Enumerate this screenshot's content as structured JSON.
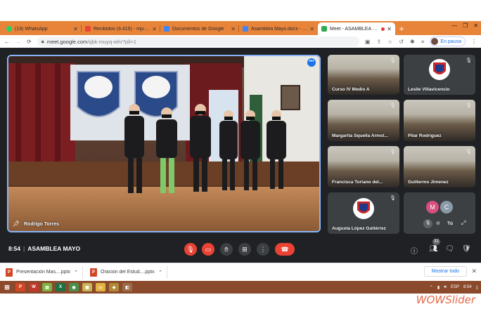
{
  "browser": {
    "tabs": [
      {
        "title": "(19) WhatsApp",
        "color": "#25d366",
        "active": false
      },
      {
        "title": "Recibidos (9.415) - mjvillanue",
        "color": "#ea4335",
        "active": false
      },
      {
        "title": "Documentos de Google",
        "color": "#4285f4",
        "active": false
      },
      {
        "title": "Asamblea Mayo.docx - Docum",
        "color": "#4285f4",
        "active": false
      },
      {
        "title": "Meet - ASAMBLEA MAYO",
        "color": "#34a853",
        "active": true
      }
    ],
    "new_tab": "+",
    "url_host": "meet.google.com",
    "url_path": "/qbk-muyq-whr?pli=1",
    "profile_status": "En pausa"
  },
  "meet": {
    "time": "8:54",
    "meeting_title": "ASAMBLEA MAYO",
    "presenter_name": "Rodrigo Torres",
    "participants_count": "32",
    "tiles": [
      {
        "name": "Curso IV Medio A"
      },
      {
        "name": "Leslie Villavicencio"
      },
      {
        "name": "Margarita Squella Armst..."
      },
      {
        "name": "Pilar Rodriguez"
      },
      {
        "name": "Francisca Toriano del..."
      },
      {
        "name": "Guillermo Jimenez"
      },
      {
        "name": "Augusta López Gutiérrez"
      }
    ],
    "self_tile": {
      "avatars": [
        "M",
        "C"
      ],
      "label": "Tú"
    }
  },
  "downloads": {
    "items": [
      {
        "name": "Presentación Mas....pptx"
      },
      {
        "name": "Oración del Estud....pptx"
      }
    ],
    "show_all": "Mostrar todo"
  },
  "taskbar": {
    "lang": "ESP",
    "clock": "8:54"
  },
  "watermark": "WOWSlider",
  "colors": {
    "accent_blue": "#8ab4f8",
    "meet_bg": "#202124",
    "hangup_red": "#ea4335",
    "tab_strip": "#e8843a"
  }
}
